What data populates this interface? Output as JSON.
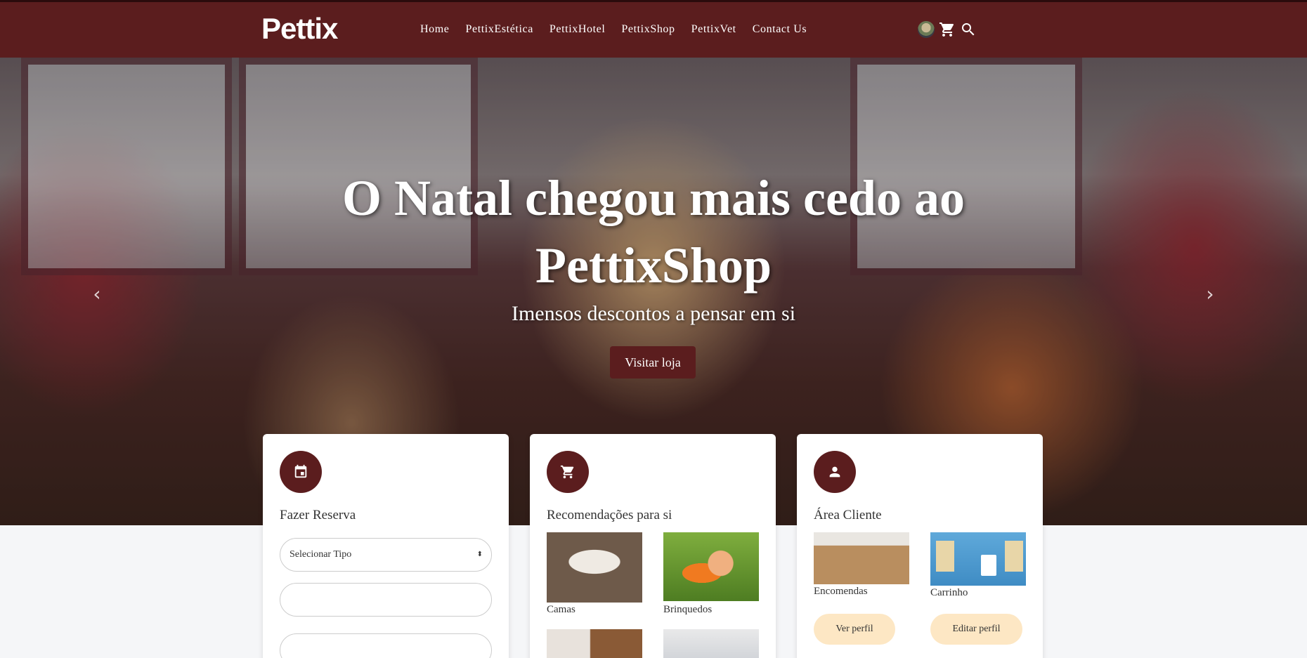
{
  "brand": {
    "logo_text": "Pettix"
  },
  "nav": {
    "links": [
      "Home",
      "PettixEstética",
      "PettixHotel",
      "PettixShop",
      "PettixVet",
      "Contact Us"
    ]
  },
  "icons": [
    "avatar",
    "cart-icon",
    "search-icon",
    "chevron-left-icon",
    "chevron-right-icon",
    "calendar-icon",
    "shopping-cart-icon",
    "person-icon"
  ],
  "hero": {
    "title_line1": "O Natal chegou mais cedo ao",
    "title_line2": "PettixShop",
    "subtitle": "Imensos descontos a pensar em si",
    "cta": "Visitar loja"
  },
  "reserva": {
    "title": "Fazer Reserva",
    "select_value": "Selecionar Tipo"
  },
  "recomendacoes": {
    "title": "Recomendações para si",
    "items": [
      "Camas",
      "Brinquedos"
    ]
  },
  "cliente": {
    "title": "Área Cliente",
    "items": [
      "Encomendas",
      "Carrinho"
    ],
    "buttons": [
      "Ver perfil",
      "Editar perfil"
    ]
  },
  "colors": {
    "primary": "#5b1d1e",
    "pill": "#fde7c4",
    "page_bg": "#f5f6f8"
  }
}
